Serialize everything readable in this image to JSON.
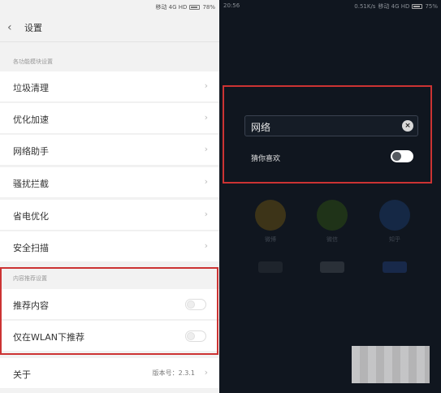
{
  "left": {
    "status": {
      "carrier": "移动 4G HD",
      "battery": "78%"
    },
    "header": {
      "title": "设置"
    },
    "section1": {
      "label": "各功能模块设置"
    },
    "items": [
      {
        "label": "垃圾清理"
      },
      {
        "label": "优化加速"
      },
      {
        "label": "网络助手"
      },
      {
        "label": "骚扰拦截"
      },
      {
        "label": "省电优化"
      },
      {
        "label": "安全扫描"
      }
    ],
    "section2": {
      "label": "内容推荐设置"
    },
    "toggles": [
      {
        "label": "推荐内容",
        "on": false
      },
      {
        "label": "仅在WLAN下推荐",
        "on": false
      }
    ],
    "about": {
      "label": "关于",
      "version": "版本号：2.3.1"
    }
  },
  "right": {
    "status": {
      "time": "20:56",
      "speed": "0.51K/s",
      "carrier": "移动 4G HD",
      "battery": "75%"
    },
    "search": {
      "value": "网络"
    },
    "guess": {
      "label": "猜你喜欢",
      "on": false
    },
    "apps": [
      {
        "label": "微博"
      },
      {
        "label": "微信"
      },
      {
        "label": "知乎"
      }
    ]
  },
  "colors": {
    "highlight": "#cc3333",
    "dark_bg": "#10161f",
    "light_bg": "#f2f2f2"
  },
  "icons": {
    "back": "chevron-left-icon",
    "chevron": "chevron-right-icon",
    "clear": "clear-icon"
  }
}
